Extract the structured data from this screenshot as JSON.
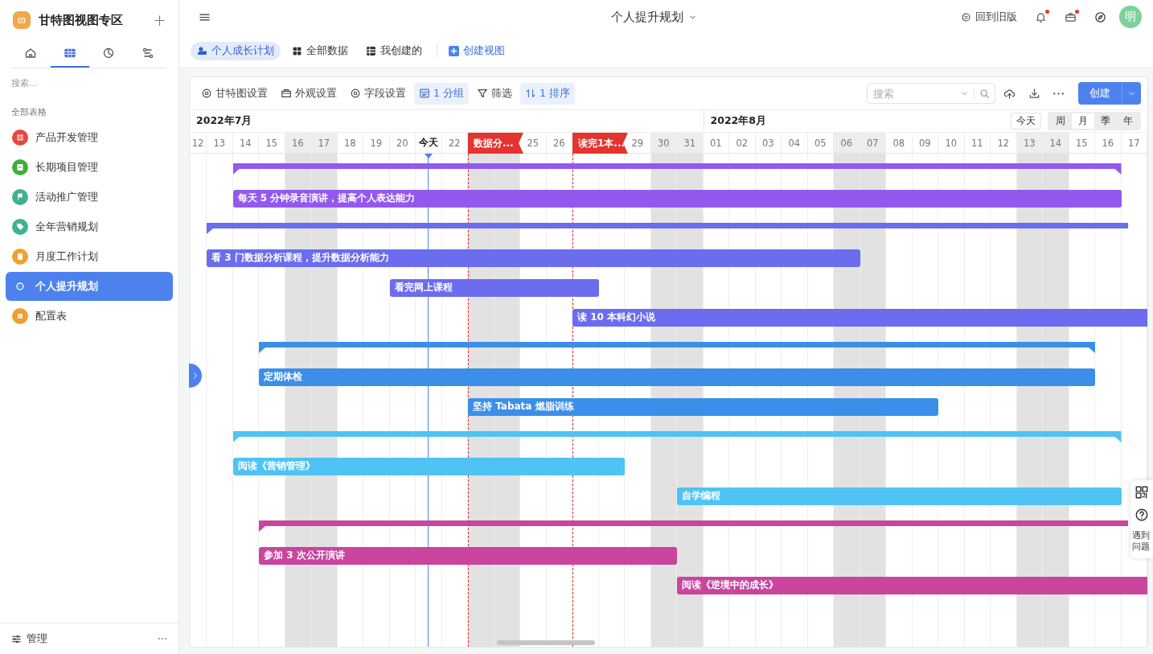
{
  "sidebar": {
    "title": "甘特图视图专区",
    "tabs": [
      {
        "kind": "home",
        "selected": false
      },
      {
        "kind": "grid",
        "selected": true
      },
      {
        "kind": "clock",
        "selected": false
      },
      {
        "kind": "flow",
        "selected": false
      }
    ],
    "search": {
      "placeholder": "搜索..."
    },
    "section": "全部表格",
    "items": [
      {
        "label": "产品开发管理",
        "kind": "grid",
        "color": "#e5483f",
        "selected": false
      },
      {
        "label": "长期项目管理",
        "kind": "card",
        "color": "#3fae3a",
        "selected": false
      },
      {
        "label": "活动推广管理",
        "kind": "flag",
        "color": "#3fb28f",
        "selected": false
      },
      {
        "label": "全年营销规划",
        "kind": "tag",
        "color": "#3fb28f",
        "selected": false
      },
      {
        "label": "月度工作计划",
        "kind": "clipboard",
        "color": "#f0a030",
        "selected": false
      },
      {
        "label": "个人提升规划",
        "kind": "face",
        "color": "#4d82ee",
        "selected": true
      },
      {
        "label": "配置表",
        "kind": "dots",
        "color": "#f0a030",
        "selected": false
      }
    ],
    "footer": "管理"
  },
  "topbar": {
    "title": "个人提升规划",
    "old_version": "回到旧版",
    "bell_dot": true,
    "box_dot": true,
    "avatar": "明"
  },
  "views": [
    {
      "label": "个人成长计划",
      "kind": "user",
      "selected": true
    },
    {
      "label": "全部数据",
      "kind": "grid",
      "selected": false
    },
    {
      "label": "我创建的",
      "kind": "list",
      "selected": false
    }
  ],
  "create_view": "创建视图",
  "toolbar": [
    {
      "label": "甘特图设置",
      "kind": "gear",
      "active": false
    },
    {
      "label": "外观设置",
      "kind": "box",
      "active": false
    },
    {
      "label": "字段设置",
      "kind": "gear",
      "active": false
    },
    {
      "label": "1 分组",
      "kind": "group",
      "active": true
    },
    {
      "label": "筛选",
      "kind": "filter",
      "active": false
    },
    {
      "label": "1 排序",
      "kind": "sort",
      "active": true
    }
  ],
  "search": {
    "placeholder": "搜索"
  },
  "create_button": "创建",
  "today_button": "今天",
  "scales": [
    {
      "label": "周",
      "selected": false
    },
    {
      "label": "月",
      "selected": true
    },
    {
      "label": "季",
      "selected": false
    },
    {
      "label": "年",
      "selected": false
    }
  ],
  "months": [
    {
      "label": "2022年7月",
      "days": [
        {
          "label": "12",
          "weekend": false,
          "today": false
        },
        {
          "label": "13",
          "weekend": false,
          "today": false
        },
        {
          "label": "14",
          "weekend": false,
          "today": false
        },
        {
          "label": "15",
          "weekend": false,
          "today": false
        },
        {
          "label": "16",
          "weekend": true,
          "today": false
        },
        {
          "label": "17",
          "weekend": true,
          "today": false
        },
        {
          "label": "18",
          "weekend": false,
          "today": false
        },
        {
          "label": "19",
          "weekend": false,
          "today": false
        },
        {
          "label": "20",
          "weekend": false,
          "today": false
        },
        {
          "label": "今天",
          "weekend": false,
          "today": true
        },
        {
          "label": "22",
          "weekend": false,
          "today": false
        },
        {
          "weekend": true,
          "today": false
        },
        {
          "weekend": true,
          "today": false
        },
        {
          "label": "25",
          "weekend": false,
          "today": false
        },
        {
          "label": "26",
          "weekend": false,
          "today": false
        },
        {
          "weekend": false,
          "today": false
        },
        {
          "weekend": false,
          "today": false
        },
        {
          "label": "29",
          "weekend": false,
          "today": false
        },
        {
          "label": "30",
          "weekend": true,
          "today": false
        },
        {
          "label": "31",
          "weekend": true,
          "today": false
        }
      ]
    },
    {
      "label": "2022年8月",
      "days": [
        {
          "label": "01",
          "weekend": false,
          "today": false
        },
        {
          "label": "02",
          "weekend": false,
          "today": false
        },
        {
          "label": "03",
          "weekend": false,
          "today": false
        },
        {
          "label": "04",
          "weekend": false,
          "today": false
        },
        {
          "label": "05",
          "weekend": false,
          "today": false
        },
        {
          "label": "06",
          "weekend": true,
          "today": false
        },
        {
          "label": "07",
          "weekend": true,
          "today": false
        },
        {
          "label": "08",
          "weekend": false,
          "today": false
        },
        {
          "label": "09",
          "weekend": false,
          "today": false
        },
        {
          "label": "10",
          "weekend": false,
          "today": false
        },
        {
          "label": "11",
          "weekend": false,
          "today": false
        },
        {
          "label": "12",
          "weekend": false,
          "today": false
        },
        {
          "label": "13",
          "weekend": true,
          "today": false
        },
        {
          "label": "14",
          "weekend": true,
          "today": false
        },
        {
          "label": "15",
          "weekend": false,
          "today": false
        },
        {
          "label": "16",
          "weekend": false,
          "today": false
        },
        {
          "label": "17",
          "weekend": false,
          "today": false
        }
      ]
    }
  ],
  "milestones": [
    {
      "label": "数据分..."
    },
    {
      "label": "读完1本..."
    }
  ],
  "groups": [
    {
      "color": "#9359ee",
      "tasks": [
        {
          "title": "每天 5 分钟录音演讲，提高个人表达能力"
        }
      ]
    },
    {
      "color": "#6b6cee",
      "tasks": [
        {
          "title": "看 3 门数据分析课程，提升数据分析能力"
        },
        {
          "title": "看完网上课程"
        },
        {
          "title": "读 10 本科幻小说"
        }
      ]
    },
    {
      "color": "#3c8fe8",
      "tasks": [
        {
          "title": "定期体检"
        },
        {
          "title": "坚持 Tabata 燃脂训练"
        }
      ]
    },
    {
      "color": "#4fc3f3",
      "tasks": [
        {
          "title": "阅读《营销管理》"
        },
        {
          "title": "自学编程"
        }
      ]
    },
    {
      "color": "#c9459e",
      "tasks": [
        {
          "title": "参加 3 次公开演讲"
        },
        {
          "title": "阅读《逆境中的成长》"
        }
      ]
    }
  ],
  "help": {
    "label": "遇到问题"
  }
}
